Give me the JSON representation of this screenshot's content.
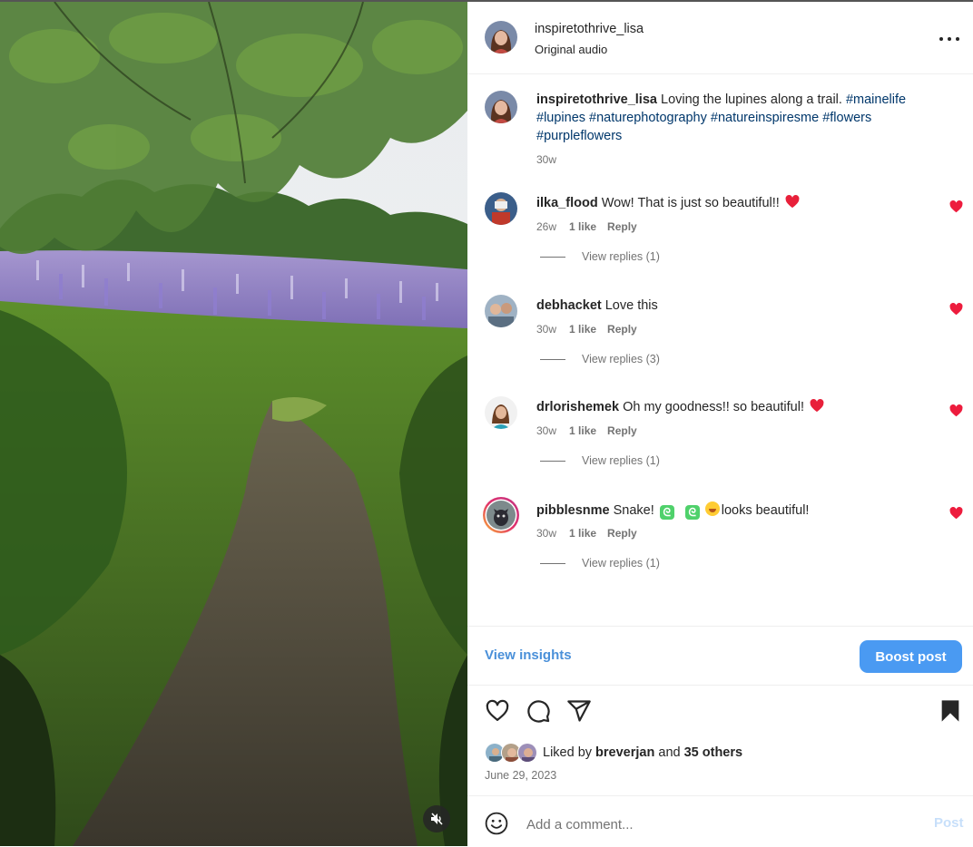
{
  "post": {
    "username": "inspiretothrive_lisa",
    "audio": "Original audio",
    "more_icon": "more-horizontal-icon"
  },
  "caption": {
    "username": "inspiretothrive_lisa",
    "text": "Loving the lupines along a trail.",
    "hashtags": [
      "#mainelife",
      "#lupines",
      "#naturephotography",
      "#natureinspiresme",
      "#flowers",
      "#purpleflowers"
    ],
    "time": "30w"
  },
  "comments": [
    {
      "username": "ilka_flood",
      "text": "Wow! That is just so beautiful!!",
      "emoji": "red-heart",
      "time": "26w",
      "likes": "1 like",
      "reply": "Reply",
      "view_replies": "View replies (1)"
    },
    {
      "username": "debhacket",
      "text": "Love this",
      "emoji": "",
      "time": "30w",
      "likes": "1 like",
      "reply": "Reply",
      "view_replies": "View replies (3)"
    },
    {
      "username": "drlorishemek",
      "text": "Oh my goodness!! so beautiful!",
      "emoji": "red-heart",
      "time": "30w",
      "likes": "1 like",
      "reply": "Reply",
      "view_replies": "View replies (1)"
    },
    {
      "username": "pibblesnme",
      "text_before": "Snake!",
      "text_after": "looks beautiful!",
      "emoji": "snake snake laughing",
      "time": "30w",
      "likes": "1 like",
      "reply": "Reply",
      "view_replies": "View replies (1)"
    }
  ],
  "insights": {
    "view_label": "View insights",
    "boost_label": "Boost post"
  },
  "actions": {
    "icons": [
      "heart-icon",
      "comment-icon",
      "share-icon",
      "bookmark-icon"
    ]
  },
  "likes": {
    "prefix": "Liked by",
    "user": "breverjan",
    "conjunction": "and",
    "others": "35 others"
  },
  "date": "June 29, 2023",
  "add_comment": {
    "placeholder": "Add a comment...",
    "post_label": "Post"
  },
  "colors": {
    "link": "#00376b",
    "accent": "#4a9af2",
    "like_red": "#ed1c3d",
    "post_disabled": "#c7dffa"
  }
}
